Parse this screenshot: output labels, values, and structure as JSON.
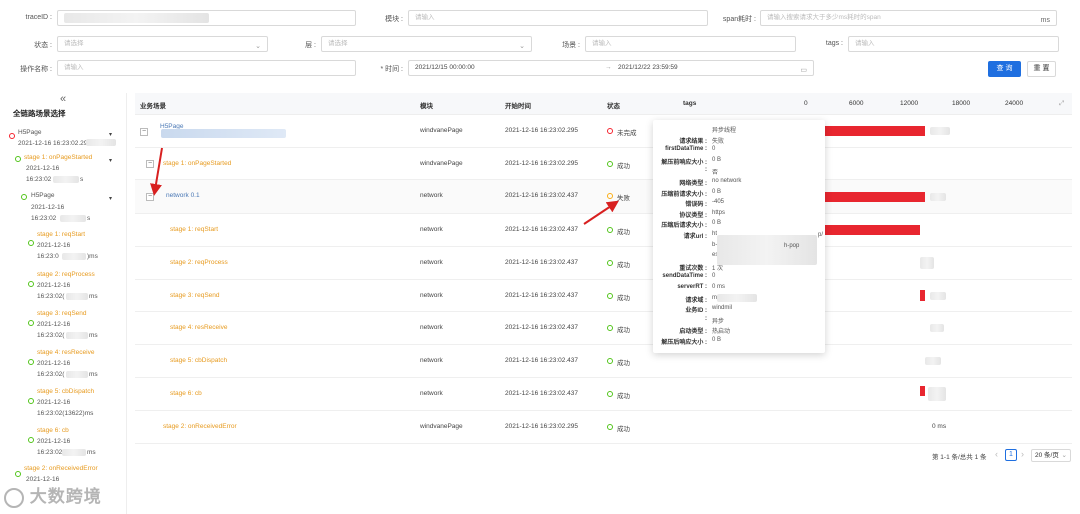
{
  "filters": {
    "traceid_label": "traceID :",
    "module_label": "模块 :",
    "module_placeholder": "请输入",
    "span_label": "span耗时 :",
    "span_placeholder": "请输入搜索请求大于多少ms耗时的span",
    "span_unit": "ms",
    "status_label": "状态 :",
    "status_placeholder": "请选择",
    "layer_label": "层 :",
    "layer_placeholder": "请选择",
    "scene_label": "场景 :",
    "scene_placeholder": "请输入",
    "tags_label": "tags :",
    "tags_placeholder": "请输入",
    "opname_label": "操作名称 :",
    "opname_placeholder": "请输入",
    "time_label": "* 时间 :",
    "time_start": "2021/12/15 00:00:00",
    "time_arrow": "→",
    "time_end": "2021/12/22 23:59:59",
    "search_button": "查 询",
    "reset_button": "重 置"
  },
  "sidebar": {
    "collapse_glyph": "«",
    "title": "全链路场景选择",
    "nodes": [
      {
        "text": "H5Page",
        "cls": "gray"
      },
      {
        "text": "2021-12-16 16:23:02.295",
        "cls": "gray"
      },
      {
        "text": "stage 1: onPageStarted",
        "cls": "orange"
      },
      {
        "text": "2021-12-16",
        "cls": "gray"
      },
      {
        "text": "16:23:02",
        "cls": "gray"
      },
      {
        "text": "s",
        "cls": "gray"
      },
      {
        "text": "H5Page",
        "cls": "gray"
      },
      {
        "text": "2021-12-16",
        "cls": "gray"
      },
      {
        "text": "16:23:02",
        "cls": "gray"
      },
      {
        "text": "s",
        "cls": "gray"
      },
      {
        "text": "stage 1: reqStart",
        "cls": "orange"
      },
      {
        "text": "2021-12-16",
        "cls": "gray"
      },
      {
        "text": "16:23:0",
        "cls": "gray"
      },
      {
        "text": ")ms",
        "cls": "gray"
      },
      {
        "text": "stage 2: reqProcess",
        "cls": "orange"
      },
      {
        "text": "2021-12-16",
        "cls": "gray"
      },
      {
        "text": "16:23:02(",
        "cls": "gray"
      },
      {
        "text": "ms",
        "cls": "gray"
      },
      {
        "text": "stage 3: reqSend",
        "cls": "orange"
      },
      {
        "text": "2021-12-16",
        "cls": "gray"
      },
      {
        "text": "16:23:02(",
        "cls": "gray"
      },
      {
        "text": "ms",
        "cls": "gray"
      },
      {
        "text": "stage 4: resReceive",
        "cls": "orange"
      },
      {
        "text": "2021-12-16",
        "cls": "gray"
      },
      {
        "text": "16:23:02(",
        "cls": "gray"
      },
      {
        "text": "ms",
        "cls": "gray"
      },
      {
        "text": "stage 5: cbDispatch",
        "cls": "orange"
      },
      {
        "text": "2021-12-16",
        "cls": "gray"
      },
      {
        "text": "16:23:02(13622)ms",
        "cls": "gray"
      },
      {
        "text": "stage 6: cb",
        "cls": "orange"
      },
      {
        "text": "2021-12-16",
        "cls": "gray"
      },
      {
        "text": "16:23:02",
        "cls": "gray"
      },
      {
        "text": "ms",
        "cls": "gray"
      },
      {
        "text": "stage 2: onReceivedError",
        "cls": "orange"
      },
      {
        "text": "2021-12-16",
        "cls": "gray"
      }
    ]
  },
  "table": {
    "headers": {
      "scene": "业务场景",
      "module": "模块",
      "start": "开始时间",
      "status": "状态",
      "tags": "tags",
      "axis_0": "0",
      "axis_1": "6000",
      "axis_2": "12000",
      "axis_3": "18000",
      "axis_4": "24000",
      "expand_icon": "⤢"
    },
    "rows": [
      {
        "scene": "H5Page",
        "module": "windvanePage",
        "start": "2021-12-16 16:23:02.295",
        "status": "未完成",
        "status_kind": "err",
        "expander": "−"
      },
      {
        "scene": "stage 1: onPageStarted",
        "module": "windvanePage",
        "start": "2021-12-16 16:23:02.295",
        "status": "成功",
        "status_kind": "ok",
        "expander": "−"
      },
      {
        "scene": "network 0.1",
        "module": "network",
        "start": "2021-12-16 16:23:02.437",
        "status": "失败",
        "status_kind": "warn",
        "expander": "−"
      },
      {
        "scene": "stage 1: reqStart",
        "module": "network",
        "start": "2021-12-16 16:23:02.437",
        "status": "成功",
        "status_kind": "ok"
      },
      {
        "scene": "stage 2: reqProcess",
        "module": "network",
        "start": "2021-12-16 16:23:02.437",
        "status": "成功",
        "status_kind": "ok"
      },
      {
        "scene": "stage 3: reqSend",
        "module": "network",
        "start": "2021-12-16 16:23:02.437",
        "status": "成功",
        "status_kind": "ok"
      },
      {
        "scene": "stage 4: resReceive",
        "module": "network",
        "start": "2021-12-16 16:23:02.437",
        "status": "成功",
        "status_kind": "ok"
      },
      {
        "scene": "stage 5: cbDispatch",
        "module": "network",
        "start": "2021-12-16 16:23:02.437",
        "status": "成功",
        "status_kind": "ok"
      },
      {
        "scene": "stage 6: cb",
        "module": "network",
        "start": "2021-12-16 16:23:02.437",
        "status": "成功",
        "status_kind": "ok"
      },
      {
        "scene": "stage 2: onReceivedError",
        "module": "windvanePage",
        "start": "2021-12-16 16:23:02.295",
        "status": "成功",
        "status_kind": "ok"
      }
    ],
    "last_row_duration": "0 ms"
  },
  "tooltip": {
    "rows": [
      {
        "k": "",
        "v": "异步线程"
      },
      {
        "k": "请求结果 :",
        "v": "失败"
      },
      {
        "k": "firstDataTime :",
        "v": "0"
      },
      {
        "k": "解压前响应大小 :",
        "v": "0  B"
      },
      {
        "k": ":",
        "v": "否"
      },
      {
        "k": "网络类型 :",
        "v": "no network"
      },
      {
        "k": "压缩前请求大小 :",
        "v": "0  B"
      },
      {
        "k": "错误码 :",
        "v": "-405"
      },
      {
        "k": "协议类型 :",
        "v": "https"
      },
      {
        "k": "压缩后请求大小 :",
        "v": "0  B"
      },
      {
        "k": "请求url :",
        "v": "ht"
      },
      {
        "k": "",
        "v": "b-"
      },
      {
        "k": "",
        "v": "es"
      },
      {
        "k": "重试次数 :",
        "v": "1  次"
      },
      {
        "k": "sendDataTime :",
        "v": "0"
      },
      {
        "k": "serverRT :",
        "v": "0  ms"
      },
      {
        "k": "请求域 :",
        "v": "m.tao"
      },
      {
        "k": "业务ID :",
        "v": "windmil"
      },
      {
        "k": ":",
        "v": "异步"
      },
      {
        "k": "启动类型 :",
        "v": "热启动"
      },
      {
        "k": "解压后响应大小 :",
        "v": "0  B"
      }
    ],
    "url_tail_1": "p/",
    "url_tail_2": "h-pop"
  },
  "pagination": {
    "summary": "第 1-1 条/总共 1 条",
    "prev": "‹",
    "page": "1",
    "next": "›",
    "page_size": "20 条/页"
  },
  "watermark": {
    "text": "大数跨境"
  }
}
